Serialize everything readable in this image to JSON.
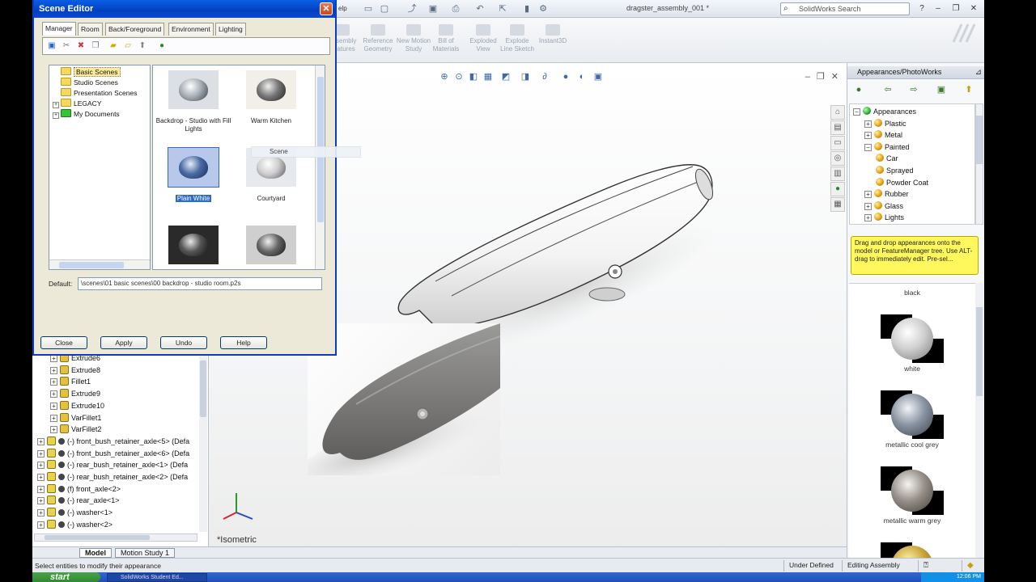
{
  "window": {
    "doc_title": "dragster_assembly_001 *",
    "search_placeholder": "SolidWorks Search",
    "menu_fragment": "elp"
  },
  "ribbon": {
    "buttons": [
      "Assembly Features",
      "Reference Geometry",
      "New Motion Study",
      "Bill of Materials",
      "Exploded View",
      "Explode Line Sketch",
      "Instant3D"
    ]
  },
  "scene_editor": {
    "title": "Scene Editor",
    "tabs": [
      "Manager",
      "Room",
      "Back/Foreground",
      "Environment",
      "Lighting"
    ],
    "active_tab": "Manager",
    "tree": [
      {
        "label": "Basic Scenes",
        "selected": true
      },
      {
        "label": "Studio Scenes"
      },
      {
        "label": "Presentation Scenes"
      },
      {
        "label": "LEGACY"
      },
      {
        "label": "My Documents"
      }
    ],
    "thumbnails": [
      {
        "label": "Backdrop - Studio with Fill Lights"
      },
      {
        "label": "Warm Kitchen"
      },
      {
        "label": "Plain White",
        "selected": true
      },
      {
        "label": "Courtyard"
      },
      {
        "label": ""
      },
      {
        "label": ""
      }
    ],
    "drag_label": "Scene",
    "default_label": "Default:",
    "default_value": "\\scenes\\01 basic scenes\\00 backdrop - studio room.p2s",
    "buttons": {
      "close": "Close",
      "apply": "Apply",
      "undo": "Undo",
      "help": "Help"
    }
  },
  "feature_tree": {
    "items": [
      {
        "label": "Extrude6",
        "indent": 1
      },
      {
        "label": "Extrude8",
        "indent": 1
      },
      {
        "label": "Fillet1",
        "indent": 1
      },
      {
        "label": "Extrude9",
        "indent": 1
      },
      {
        "label": "Extrude10",
        "indent": 1
      },
      {
        "label": "VarFillet1",
        "indent": 1
      },
      {
        "label": "VarFillet2",
        "indent": 1
      },
      {
        "label": "(-) front_bush_retainer_axle<5> (Defa",
        "indent": 0
      },
      {
        "label": "(-) front_bush_retainer_axle<6> (Defa",
        "indent": 0
      },
      {
        "label": "(-) rear_bush_retainer_axle<1> (Defa",
        "indent": 0
      },
      {
        "label": "(-) rear_bush_retainer_axle<2> (Defa",
        "indent": 0
      },
      {
        "label": "(f) front_axle<2>",
        "indent": 0
      },
      {
        "label": "(-) rear_axle<1>",
        "indent": 0
      },
      {
        "label": "(-) washer<1>",
        "indent": 0
      },
      {
        "label": "(-) washer<2>",
        "indent": 0
      }
    ]
  },
  "viewport": {
    "view_label": "*Isometric"
  },
  "bottom_tabs": [
    "Model",
    "Motion Study 1"
  ],
  "status": {
    "message": "Select entities to modify their appearance",
    "defined": "Under Defined",
    "mode": "Editing Assembly"
  },
  "taskbar": {
    "start": "start",
    "item": "SolidWorks Student Ed...",
    "time": "12:06 PM"
  },
  "appearances": {
    "title": "Appearances/PhotoWorks",
    "tree": [
      {
        "label": "Appearances",
        "level": 0,
        "icon": "ball"
      },
      {
        "label": "Plastic",
        "level": 1,
        "icon": "ball"
      },
      {
        "label": "Metal",
        "level": 1,
        "icon": "ball"
      },
      {
        "label": "Painted",
        "level": 1,
        "icon": "ball"
      },
      {
        "label": "Car",
        "level": 2,
        "icon": "ball"
      },
      {
        "label": "Sprayed",
        "level": 2,
        "icon": "ball"
      },
      {
        "label": "Powder Coat",
        "level": 2,
        "icon": "ball"
      },
      {
        "label": "Rubber",
        "level": 1,
        "icon": "ball"
      },
      {
        "label": "Glass",
        "level": 1,
        "icon": "ball"
      },
      {
        "label": "Lights",
        "level": 1,
        "icon": "ball"
      }
    ],
    "tip": "Drag and drop appearances onto the model or FeatureManager tree.  Use ALT-drag to immediately edit.  Pre-sel...",
    "swatches": [
      "black",
      "white",
      "metallic cool grey",
      "metallic warm grey"
    ]
  }
}
